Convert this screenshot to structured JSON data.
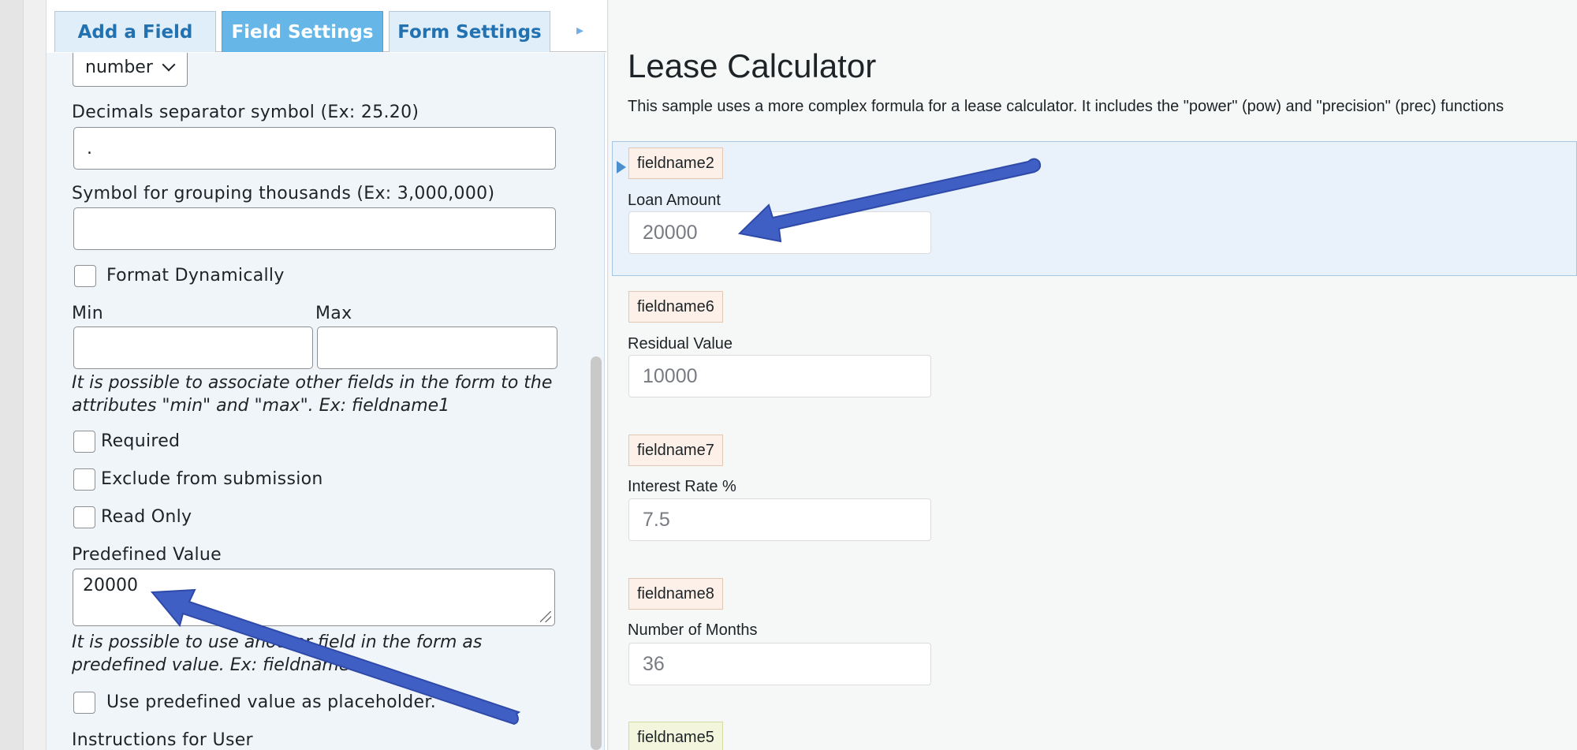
{
  "tabs": {
    "add_field": "Add a Field",
    "field_settings": "Field Settings",
    "form_settings": "Form Settings",
    "more_icon": "triangle-right-icon"
  },
  "settings": {
    "format_select": "number",
    "decimals_label": "Decimals separator symbol (Ex: 25.20)",
    "decimals_value": ".",
    "grouping_label": "Symbol for grouping thousands (Ex: 3,000,000)",
    "grouping_value": "",
    "format_dynamically": "Format Dynamically",
    "min_label": "Min",
    "max_label": "Max",
    "min_value": "",
    "max_value": "",
    "minmax_help_1": "It is possible to associate other fields in the form to the",
    "minmax_help_2": "attributes \"min\" and \"max\". Ex: fieldname1",
    "required": "Required",
    "exclude": "Exclude from submission",
    "read_only": "Read Only",
    "predefined_label": "Predefined Value",
    "predefined_value": "20000",
    "predefined_help_1": "It is possible to use another field in the form as",
    "predefined_help_2": "predefined value. Ex: fieldname1",
    "use_placeholder": "Use predefined value as placeholder.",
    "instructions_label": "Instructions for User"
  },
  "preview": {
    "title": "Lease Calculator",
    "description": "This sample uses a more complex formula for a lease calculator. It includes the \"power\" (pow) and \"precision\" (prec) functions",
    "fields": [
      {
        "name": "fieldname2",
        "label": "Loan Amount",
        "value": "20000"
      },
      {
        "name": "fieldname6",
        "label": "Residual Value",
        "value": "10000"
      },
      {
        "name": "fieldname7",
        "label": "Interest Rate %",
        "value": "7.5"
      },
      {
        "name": "fieldname8",
        "label": "Number of Months",
        "value": "36"
      },
      {
        "name": "fieldname5"
      }
    ]
  },
  "colors": {
    "accent": "#66b7e8",
    "arrow": "#3f5fc4",
    "selected_bg": "#e9f2fa"
  }
}
